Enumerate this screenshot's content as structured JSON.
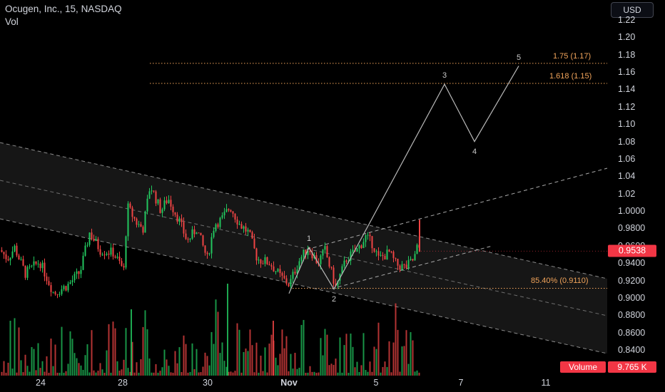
{
  "header": {
    "symbol_line": "Ocugen, Inc., 15, NASDAQ",
    "indicator": "Vol"
  },
  "currency_button": "USD",
  "price_axis": {
    "ticks": [
      "1.22",
      "1.20",
      "1.18",
      "1.16",
      "1.14",
      "1.12",
      "1.10",
      "1.08",
      "1.06",
      "1.04",
      "1.02",
      "1.0000",
      "0.9800",
      "0.9600",
      "0.9400",
      "0.9200",
      "0.9000",
      "0.8800",
      "0.8600",
      "0.8400"
    ],
    "current_price": "0.9538"
  },
  "time_axis": {
    "ticks": [
      {
        "label": "24",
        "bold": false
      },
      {
        "label": "28",
        "bold": false
      },
      {
        "label": "30",
        "bold": false
      },
      {
        "label": "Nov",
        "bold": true
      },
      {
        "label": "5",
        "bold": false
      },
      {
        "label": "7",
        "bold": false
      },
      {
        "label": "11",
        "bold": false
      }
    ]
  },
  "volume": {
    "label": "Volume",
    "value": "9.765 K"
  },
  "fib_levels": [
    {
      "label": "1.75 (1.17)",
      "price": 1.17
    },
    {
      "label": "1.618 (1.15)",
      "price": 1.147
    },
    {
      "label": "85.40% (0.9110)",
      "price": 0.911
    }
  ],
  "wave_labels": [
    "1",
    "2",
    "3",
    "4",
    "5"
  ],
  "colors": {
    "background": "#000000",
    "up": "#22c55e",
    "down": "#ef4444",
    "fib": "#f0a35a",
    "badge": "#f23645",
    "text": "#d1d4dc",
    "grid_text": "#d1d4dc"
  },
  "chart_data": {
    "type": "candlestick",
    "symbol": "Ocugen, Inc.",
    "interval": "15",
    "exchange": "NASDAQ",
    "ylim": [
      0.83,
      1.23
    ],
    "x_ticks": [
      "24",
      "28",
      "30",
      "Nov",
      "5",
      "7",
      "11"
    ],
    "last_price": 0.9538,
    "last_volume": "9.765 K",
    "elliott_wave": [
      {
        "label": "1",
        "price": 0.958
      },
      {
        "label": "2",
        "price": 0.91
      },
      {
        "label": "3",
        "price": 1.146
      },
      {
        "label": "4",
        "price": 1.08
      },
      {
        "label": "5",
        "price": 1.167
      }
    ],
    "fib_extensions": [
      {
        "ratio": "1.75",
        "price": 1.17
      },
      {
        "ratio": "1.618",
        "price": 1.15
      },
      {
        "ratio": "85.40%",
        "price": 0.911
      }
    ]
  }
}
